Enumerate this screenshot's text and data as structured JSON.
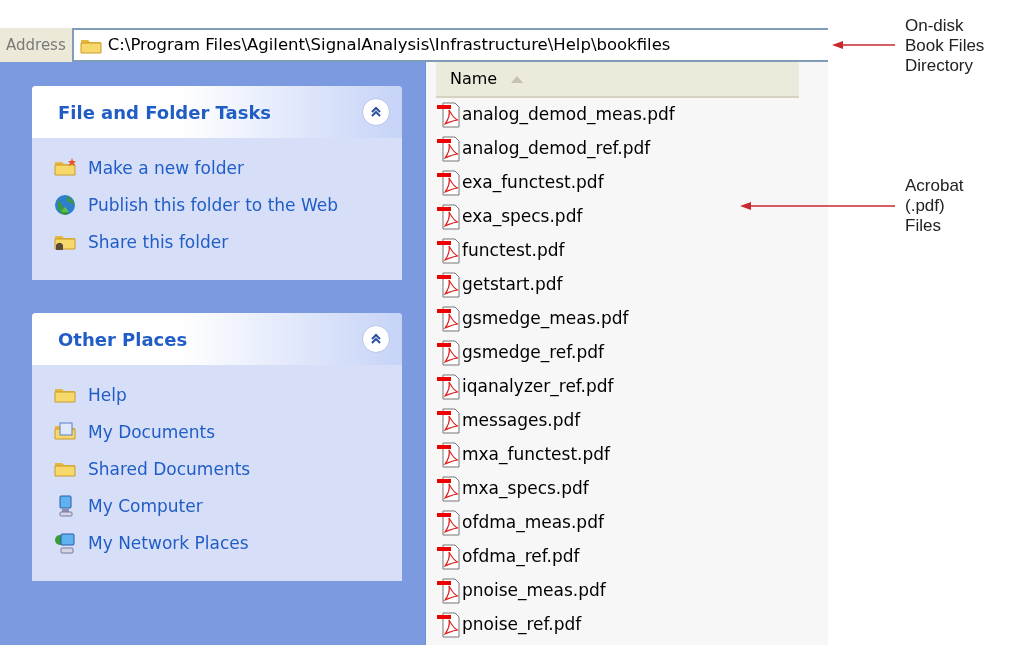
{
  "address_bar": {
    "label": "Address",
    "path": "C:\\Program Files\\Agilent\\SignalAnalysis\\Infrastructure\\Help\\bookfiles"
  },
  "task_panels": [
    {
      "title": "File and Folder Tasks",
      "expanded": true,
      "items": [
        {
          "label": "Make a new folder",
          "kind": "new-folder"
        },
        {
          "label": "Publish this folder to the Web",
          "kind": "globe"
        },
        {
          "label": "Share this folder",
          "kind": "share"
        }
      ]
    },
    {
      "title": "Other Places",
      "expanded": true,
      "items": [
        {
          "label": "Help",
          "kind": "folder"
        },
        {
          "label": "My Documents",
          "kind": "documents"
        },
        {
          "label": "Shared Documents",
          "kind": "folder"
        },
        {
          "label": "My Computer",
          "kind": "computer"
        },
        {
          "label": "My Network Places",
          "kind": "network"
        }
      ]
    }
  ],
  "file_list": {
    "columns": [
      {
        "label": "Name",
        "sorted": true
      }
    ],
    "files": [
      "analog_demod_meas.pdf",
      "analog_demod_ref.pdf",
      "exa_functest.pdf",
      "exa_specs.pdf",
      "functest.pdf",
      "getstart.pdf",
      "gsmedge_meas.pdf",
      "gsmedge_ref.pdf",
      "iqanalyzer_ref.pdf",
      "messages.pdf",
      "mxa_functest.pdf",
      "mxa_specs.pdf",
      "ofdma_meas.pdf",
      "ofdma_ref.pdf",
      "pnoise_meas.pdf",
      "pnoise_ref.pdf"
    ]
  },
  "annotations": [
    {
      "lines": [
        "On-disk",
        "Book Files",
        "Directory"
      ],
      "kind": "address"
    },
    {
      "lines": [
        "Acrobat",
        "(.pdf)",
        "Files"
      ],
      "kind": "files"
    }
  ]
}
